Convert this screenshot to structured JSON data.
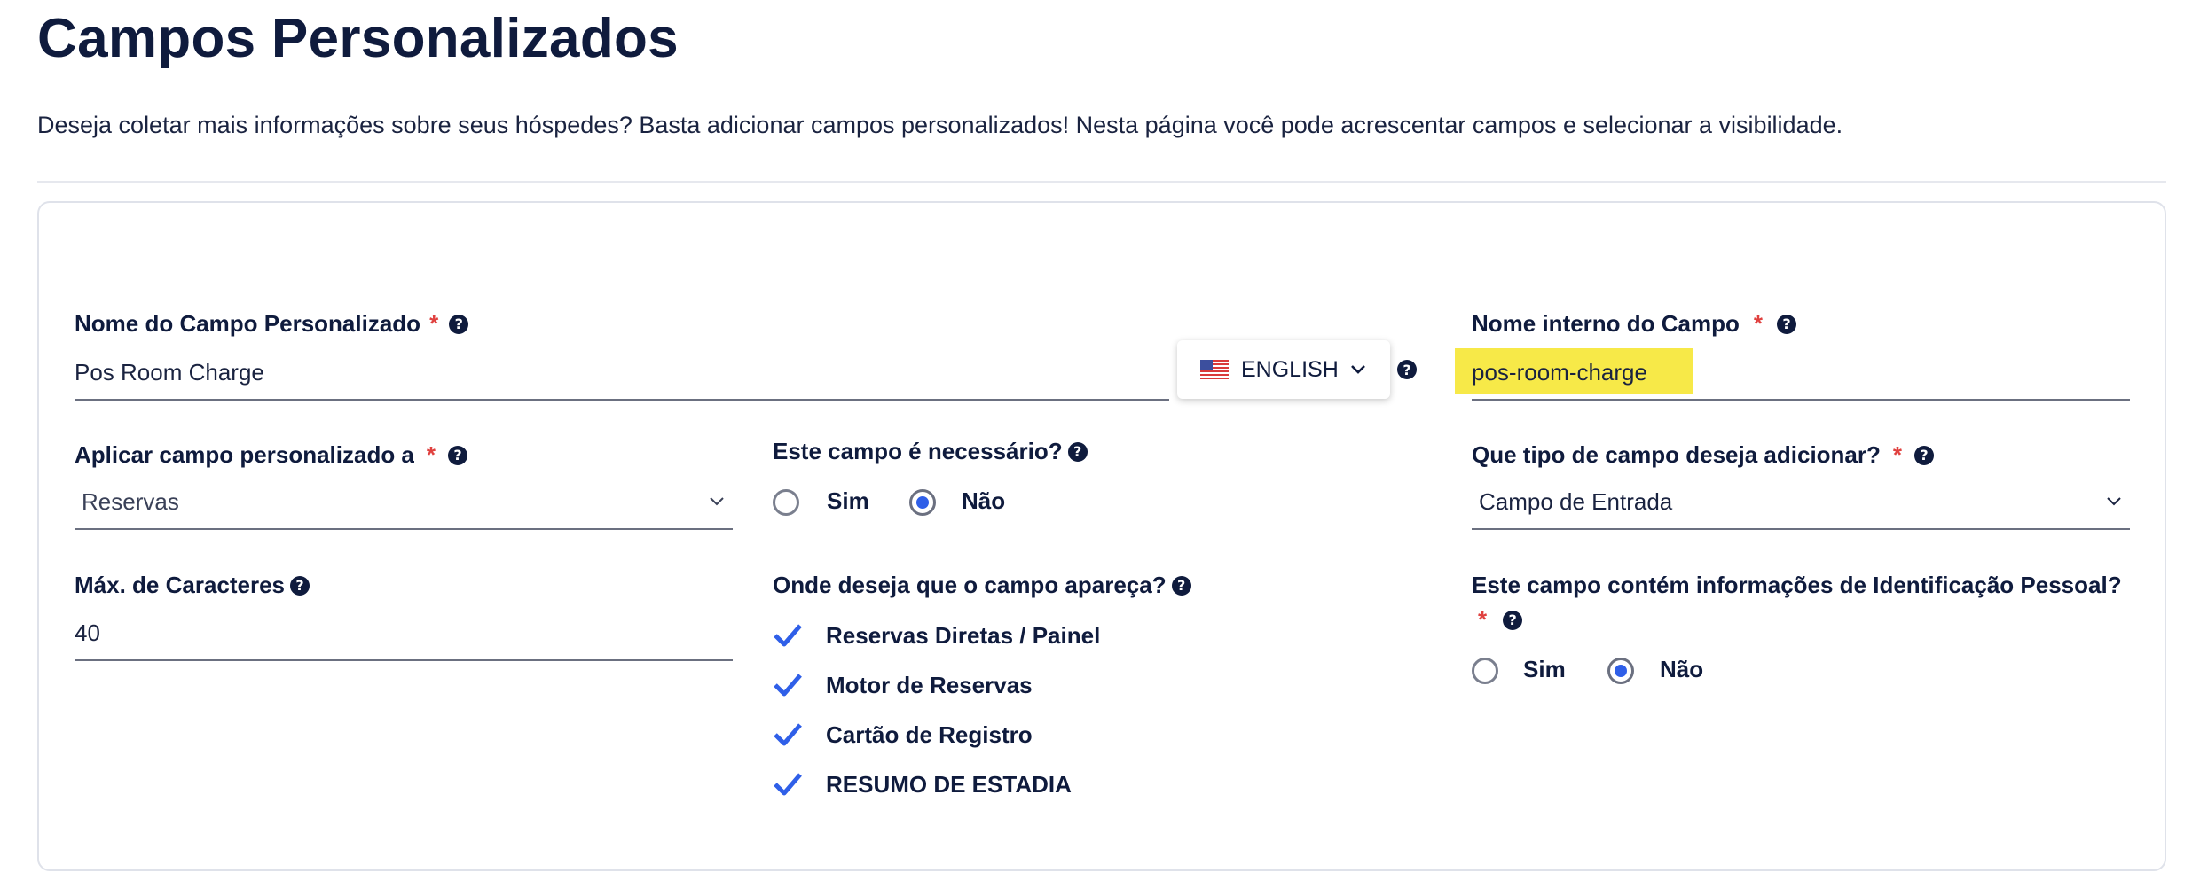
{
  "page": {
    "title": "Campos Personalizados",
    "subtitle": "Deseja coletar mais informações sobre seus hóspedes? Basta adicionar campos personalizados! Nesta página você pode acrescentar campos e selecionar a visibilidade."
  },
  "form": {
    "custom_field_name": {
      "label": "Nome do Campo Personalizado",
      "required_mark": "*",
      "value": "Pos Room Charge"
    },
    "language": {
      "label": "ENGLISH",
      "flag": "us-flag-icon"
    },
    "internal_name": {
      "label": "Nome interno do Campo",
      "required_mark": "*",
      "value": "pos-room-charge"
    },
    "apply_to": {
      "label": "Aplicar campo personalizado a",
      "required_mark": "*",
      "value": "Reservas"
    },
    "is_required": {
      "label": "Este campo é necessário?",
      "options": [
        "Sim",
        "Não"
      ],
      "selected": "Não"
    },
    "field_type": {
      "label": "Que tipo de campo deseja adicionar?",
      "required_mark": "*",
      "value": "Campo de Entrada"
    },
    "max_chars": {
      "label": "Máx. de Caracteres",
      "value": "40"
    },
    "visibility": {
      "label": "Onde deseja que o campo apareça?",
      "options": [
        "Reservas Diretas / Painel",
        "Motor de Reservas",
        "Cartão de Registro",
        "RESUMO DE ESTADIA"
      ],
      "checked": [
        true,
        true,
        true,
        true
      ]
    },
    "pii": {
      "label": "Este campo contém informações de Identificação Pessoal?",
      "required_mark": "*",
      "options": [
        "Sim",
        "Não"
      ],
      "selected": "Não"
    }
  },
  "colors": {
    "accent": "#2f5fe8",
    "highlight": "#f7e948",
    "required": "#e0413f",
    "text": "#0f1b3d"
  }
}
